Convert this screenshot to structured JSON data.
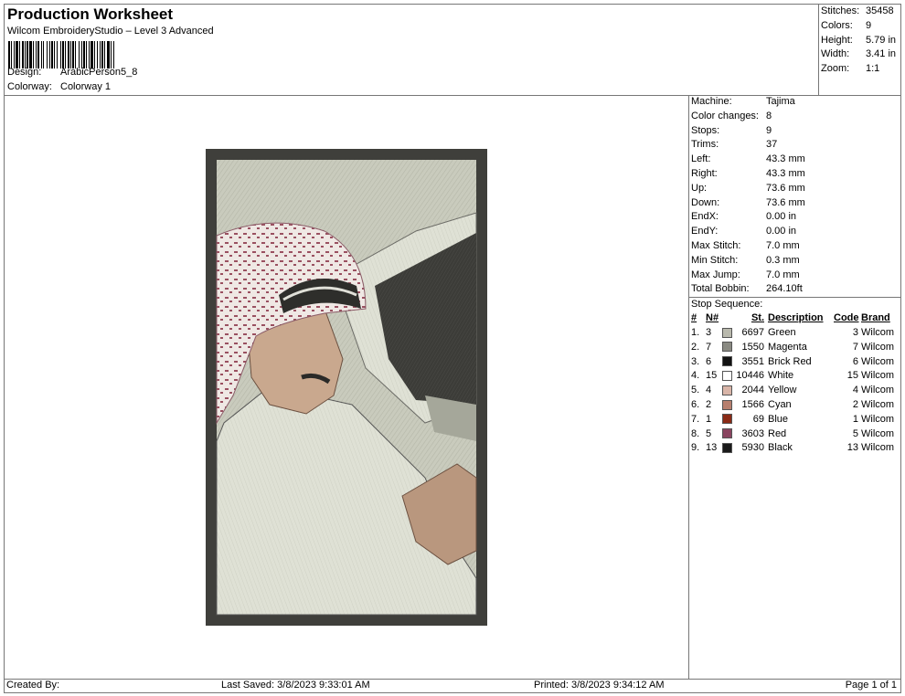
{
  "header": {
    "title": "Production Worksheet",
    "subtitle": "Wilcom EmbroideryStudio – Level 3 Advanced",
    "design_label": "Design:",
    "design_value": "ArabicPerson5_8",
    "colorway_label": "Colorway:",
    "colorway_value": "Colorway 1"
  },
  "summary": [
    {
      "k": "Stitches:",
      "v": "35458"
    },
    {
      "k": "Colors:",
      "v": "9"
    },
    {
      "k": "Height:",
      "v": "5.79 in"
    },
    {
      "k": "Width:",
      "v": "3.41 in"
    },
    {
      "k": "Zoom:",
      "v": "1:1"
    }
  ],
  "stats": [
    {
      "k": "Machine:",
      "v": "Tajima"
    },
    {
      "k": "Color changes:",
      "v": "8"
    },
    {
      "k": "Stops:",
      "v": "9"
    },
    {
      "k": "Trims:",
      "v": "37"
    },
    {
      "k": "Left:",
      "v": "43.3 mm"
    },
    {
      "k": "Right:",
      "v": "43.3 mm"
    },
    {
      "k": "Up:",
      "v": "73.6 mm"
    },
    {
      "k": "Down:",
      "v": "73.6 mm"
    },
    {
      "k": "EndX:",
      "v": "0.00 in"
    },
    {
      "k": "EndY:",
      "v": "0.00 in"
    },
    {
      "k": "Max Stitch:",
      "v": "7.0 mm"
    },
    {
      "k": "Min Stitch:",
      "v": "0.3 mm"
    },
    {
      "k": "Max Jump:",
      "v": "7.0 mm"
    },
    {
      "k": "Total Bobbin:",
      "v": "264.10ft"
    }
  ],
  "sequence": {
    "title": "Stop Sequence:",
    "headers": {
      "idx": "#",
      "n": "N#",
      "st": "St.",
      "desc": "Description",
      "code": "Code",
      "brand": "Brand"
    },
    "rows": [
      {
        "idx": "1.",
        "n": "3",
        "color": "#b9b9ad",
        "st": "6697",
        "desc": "Green",
        "code": "3",
        "brand": "Wilcom"
      },
      {
        "idx": "2.",
        "n": "7",
        "color": "#8a8a82",
        "st": "1550",
        "desc": "Magenta",
        "code": "7",
        "brand": "Wilcom"
      },
      {
        "idx": "3.",
        "n": "6",
        "color": "#121212",
        "st": "3551",
        "desc": "Brick Red",
        "code": "6",
        "brand": "Wilcom"
      },
      {
        "idx": "4.",
        "n": "15",
        "color": "#ffffff",
        "st": "10446",
        "desc": "White",
        "code": "15",
        "brand": "Wilcom"
      },
      {
        "idx": "5.",
        "n": "4",
        "color": "#d9b5a8",
        "st": "2044",
        "desc": "Yellow",
        "code": "4",
        "brand": "Wilcom"
      },
      {
        "idx": "6.",
        "n": "2",
        "color": "#b77f6e",
        "st": "1566",
        "desc": "Cyan",
        "code": "2",
        "brand": "Wilcom"
      },
      {
        "idx": "7.",
        "n": "1",
        "color": "#8a2a16",
        "st": "69",
        "desc": "Blue",
        "code": "1",
        "brand": "Wilcom"
      },
      {
        "idx": "8.",
        "n": "5",
        "color": "#8a4560",
        "st": "3603",
        "desc": "Red",
        "code": "5",
        "brand": "Wilcom"
      },
      {
        "idx": "9.",
        "n": "13",
        "color": "#1a1a1a",
        "st": "5930",
        "desc": "Black",
        "code": "13",
        "brand": "Wilcom"
      }
    ]
  },
  "footer": {
    "created": "Created By:",
    "last_saved": "Last Saved: 3/8/2023 9:33:01 AM",
    "printed": "Printed: 3/8/2023 9:34:12 AM",
    "page": "Page 1 of 1"
  }
}
